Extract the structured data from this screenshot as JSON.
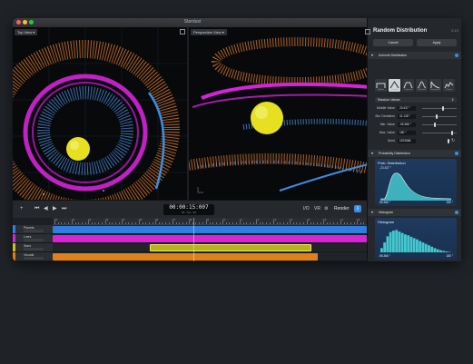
{
  "window": {
    "title": "Stardust",
    "traffic_lights": [
      "#ff5f57",
      "#febc2e",
      "#28c840"
    ]
  },
  "viewports": [
    {
      "menu_label": "Top View"
    },
    {
      "menu_label": "Perspective View"
    }
  ],
  "timeline": {
    "timecode": "00:00:15:007",
    "timecode_sub": "00  fps  00",
    "io_label": "I/O",
    "vr_label": "VR",
    "render_label": "Render",
    "ruler_labels": [
      "00",
      "01",
      "02",
      "03",
      "04",
      "05",
      "06",
      "07",
      "08",
      "09",
      "10",
      "11",
      "12",
      "13",
      "14",
      "15",
      "16",
      "17",
      "18"
    ],
    "tracks": [
      {
        "name": "Planets",
        "color": "#2e7fe0"
      },
      {
        "name": "Lines",
        "color": "#d624d6"
      },
      {
        "name": "Stars",
        "color": "#c8c416"
      },
      {
        "name": "Visuals",
        "color": "#e0801c"
      }
    ],
    "clips": [
      {
        "track": 0,
        "start": 0.0,
        "end": 1.0,
        "color": "#2e7fe0"
      },
      {
        "track": 1,
        "start": 0.0,
        "end": 1.0,
        "color": "#d624d6"
      },
      {
        "track": 2,
        "start": 0.305,
        "end": 0.81,
        "color": "#b9b31a"
      },
      {
        "track": 3,
        "start": 0.0,
        "end": 0.83,
        "color": "#e0801c"
      }
    ],
    "playhead_position": 0.44
  },
  "panel": {
    "title": "Random Distribution",
    "version": "2.1.0",
    "cancel_label": "Cancel",
    "apply_label": "Apply",
    "sections": {
      "azimuth": "Azimuth Distribution",
      "probability": "Probability Distribution",
      "histogram": "Histogram"
    },
    "shape_labels": [
      "Uniform",
      "Triangle",
      "Trapezoid",
      "Gaussian",
      "Exponential",
      "Custom"
    ],
    "selected_shape": 1,
    "random_values_select": "Random Values",
    "params": [
      {
        "label": "Middle Value",
        "value": "23.437 °",
        "fraction": 0.62
      },
      {
        "label": "Std. Deviation",
        "value": "41.128 °",
        "fraction": 0.42
      },
      {
        "label": "Min. Value",
        "value": "-96.366 °",
        "fraction": 0.36
      },
      {
        "label": "Max. Value",
        "value": "180 °",
        "fraction": 0.88
      },
      {
        "label": "Seed",
        "value": "1870686",
        "fraction": 0.78
      }
    ],
    "prob_graph": {
      "title": "Prob. Distribution",
      "sub": "-23.437 °",
      "min": "-96.366 °",
      "max": "180 °"
    },
    "histogram": {
      "title": "Histogram",
      "min": "-96.366 °",
      "max": "180 °",
      "bars": [
        0.18,
        0.42,
        0.68,
        0.86,
        0.92,
        0.95,
        0.88,
        0.82,
        0.76,
        0.72,
        0.66,
        0.6,
        0.55,
        0.48,
        0.42,
        0.36,
        0.3,
        0.24,
        0.18,
        0.13,
        0.09,
        0.06,
        0.04,
        0.02
      ]
    }
  }
}
